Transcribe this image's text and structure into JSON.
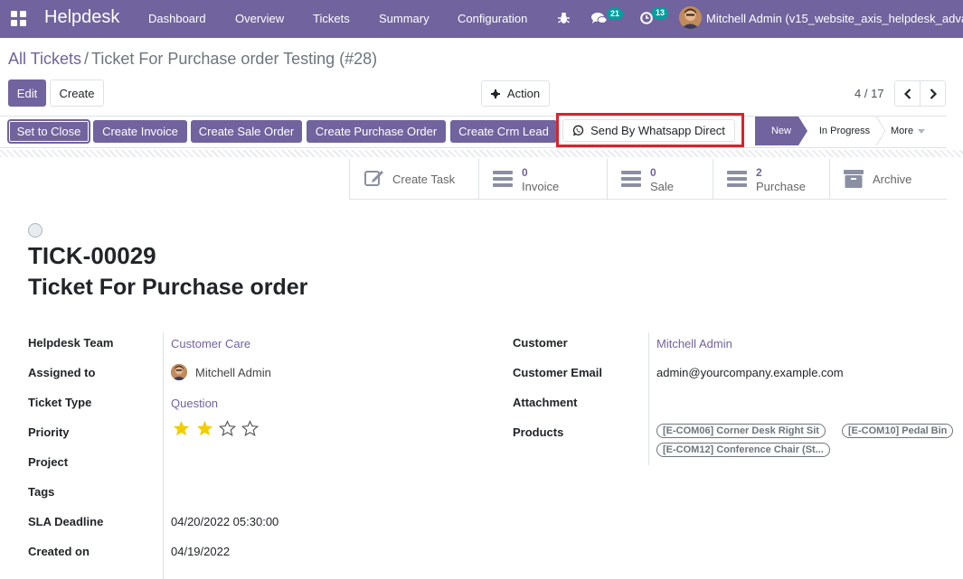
{
  "topbar": {
    "app_name": "Helpdesk",
    "menu": [
      "Dashboard",
      "Overview",
      "Tickets",
      "Summary",
      "Configuration"
    ],
    "messages_count": "21",
    "activities_count": "13",
    "user": "Mitchell Admin (v15_website_axis_helpdesk_adva"
  },
  "breadcrumb": {
    "parent": "All Tickets",
    "separator": "/",
    "current": "Ticket For Purchase order Testing (#28)"
  },
  "control": {
    "edit": "Edit",
    "create": "Create",
    "action": "Action",
    "pager": "4 / 17"
  },
  "header_buttons": [
    "Set to Close",
    "Create Invoice",
    "Create Sale Order",
    "Create Purchase Order",
    "Create Crm Lead"
  ],
  "whatsapp_button": "Send By Whatsapp Direct",
  "stages": {
    "new": "New",
    "in_progress": "In Progress",
    "more": "More"
  },
  "smart_buttons": {
    "create_task": "Create Task",
    "invoice": {
      "count": "0",
      "label": "Invoice"
    },
    "sale": {
      "count": "0",
      "label": "Sale"
    },
    "purchase": {
      "count": "2",
      "label": "Purchase"
    },
    "archive": "Archive"
  },
  "ticket": {
    "reference": "TICK-00029",
    "name": "Ticket For Purchase order"
  },
  "fields_left": {
    "team_label": "Helpdesk Team",
    "team_value": "Customer Care",
    "assigned_label": "Assigned to",
    "assigned_value": "Mitchell Admin",
    "type_label": "Ticket Type",
    "type_value": "Question",
    "priority_label": "Priority",
    "priority_value": 2,
    "priority_max": 4,
    "project_label": "Project",
    "tags_label": "Tags",
    "sla_label": "SLA Deadline",
    "sla_value": "04/20/2022 05:30:00",
    "created_label": "Created on",
    "created_value": "04/19/2022"
  },
  "fields_right": {
    "customer_label": "Customer",
    "customer_value": "Mitchell Admin",
    "email_label": "Customer Email",
    "email_value": "admin@yourcompany.example.com",
    "attachment_label": "Attachment",
    "products_label": "Products",
    "products": [
      "[E-COM06] Corner Desk Right Sit",
      "[E-COM10] Pedal Bin",
      "[E-COM12] Conference Chair (St..."
    ]
  },
  "colors": {
    "brand": "#71639e",
    "badge": "#00a09d",
    "star": "#f3cc00",
    "highlight_border": "#d9232b"
  }
}
